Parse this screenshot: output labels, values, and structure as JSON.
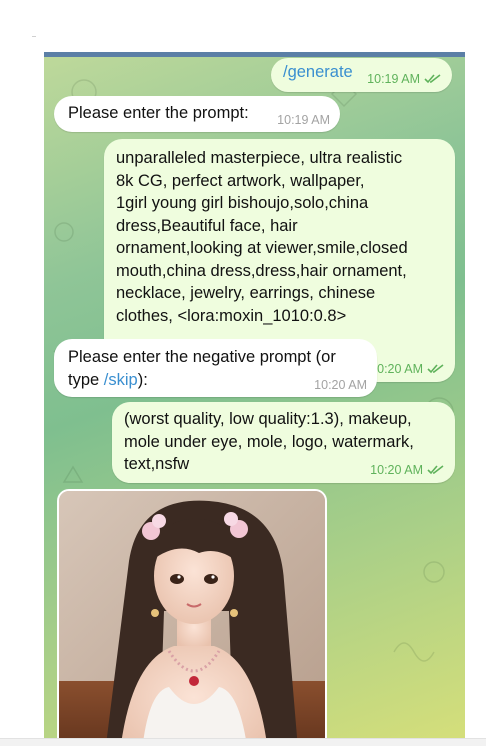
{
  "messages": [
    {
      "side": "out",
      "command": "/generate",
      "time": "10:19 AM",
      "read": true
    },
    {
      "side": "in",
      "text": "Please enter the prompt:",
      "time": "10:19 AM"
    },
    {
      "side": "out",
      "lines": [
        "unparalleled masterpiece, ultra realistic",
        "8k CG, perfect artwork, wallpaper,",
        "1girl young girl bishoujo,solo,china",
        "dress,Beautiful face, hair",
        "ornament,looking at viewer,smile,closed",
        "mouth,china dress,dress,hair ornament,",
        "necklace, jewelry, earrings, chinese",
        "clothes, <lora:moxin_1010:0.8>"
      ],
      "time": "10:20 AM",
      "read": true
    },
    {
      "side": "in",
      "line1": "Please enter the negative prompt (or",
      "prefix": "type ",
      "command": "/skip",
      "suffix": "):",
      "time": "10:20 AM"
    },
    {
      "side": "out",
      "lines": [
        "(worst quality, low quality:1.3), makeup,",
        "mole under eye, mole, logo, watermark,",
        "text,nsfw"
      ],
      "time": "10:20 AM",
      "read": true
    },
    {
      "side": "in",
      "type": "photo",
      "description_icon": "generated-image"
    }
  ],
  "colors": {
    "outgoing_bubble": "#effdde",
    "incoming_bubble": "#ffffff",
    "outgoing_meta": "#5fb25b",
    "incoming_meta": "#a3a3a3",
    "link": "#3a8fd0",
    "header_accent": "#5b7fa6"
  }
}
